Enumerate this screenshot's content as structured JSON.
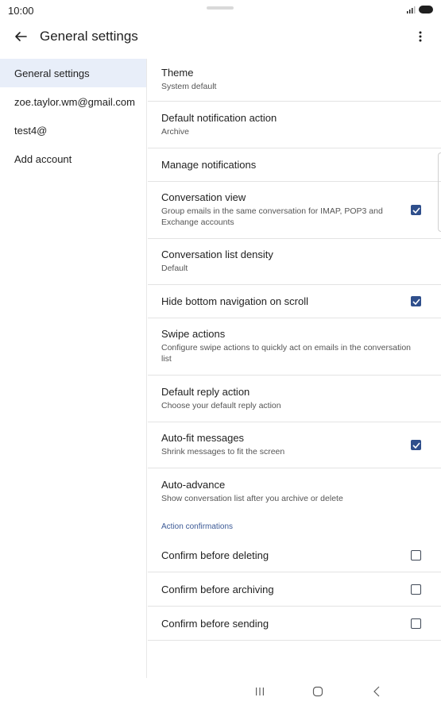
{
  "status_bar": {
    "time": "10:00"
  },
  "app_bar": {
    "title": "General settings"
  },
  "sidebar": {
    "items": [
      {
        "label": "General settings",
        "active": true
      },
      {
        "label": "zoe.taylor.wm@gmail.com",
        "active": false
      },
      {
        "label": "test4@",
        "active": false
      },
      {
        "label": "Add account",
        "active": false
      }
    ]
  },
  "settings": {
    "theme": {
      "title": "Theme",
      "sub": "System default"
    },
    "default_notification_action": {
      "title": "Default notification action",
      "sub": "Archive"
    },
    "manage_notifications": {
      "title": "Manage notifications"
    },
    "conversation_view": {
      "title": "Conversation view",
      "sub": "Group emails in the same conversation for IMAP, POP3 and Exchange accounts",
      "checked": true
    },
    "conversation_list_density": {
      "title": "Conversation list density",
      "sub": "Default"
    },
    "hide_bottom_navigation": {
      "title": "Hide bottom navigation on scroll",
      "checked": true
    },
    "swipe_actions": {
      "title": "Swipe actions",
      "sub": "Configure swipe actions to quickly act on emails in the conversation list"
    },
    "default_reply_action": {
      "title": "Default reply action",
      "sub": "Choose your default reply action"
    },
    "auto_fit_messages": {
      "title": "Auto-fit messages",
      "sub": "Shrink messages to fit the screen",
      "checked": true
    },
    "auto_advance": {
      "title": "Auto-advance",
      "sub": "Show conversation list after you archive or delete"
    },
    "action_confirmations_header": "Action confirmations",
    "confirm_before_deleting": {
      "title": "Confirm before deleting",
      "checked": false
    },
    "confirm_before_archiving": {
      "title": "Confirm before archiving",
      "checked": false
    },
    "confirm_before_sending": {
      "title": "Confirm before sending",
      "checked": false
    }
  },
  "colors": {
    "accent": "#2f4f8c",
    "section_header": "#3c5a96",
    "sidebar_active_bg": "#e8eef9"
  },
  "icons": {
    "back": "arrow-back-icon",
    "more": "more-vert-icon",
    "check": "check-icon",
    "nav_recents": "recents-icon",
    "nav_home": "home-icon",
    "nav_back": "nav-back-icon"
  }
}
